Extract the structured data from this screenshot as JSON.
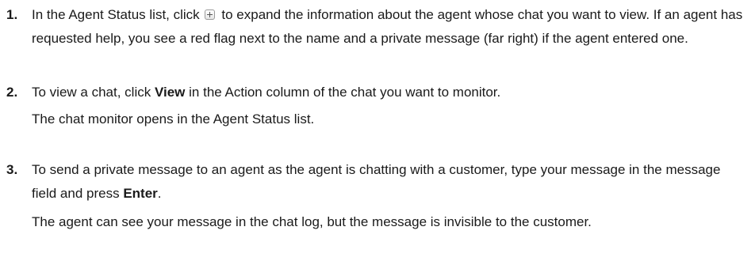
{
  "steps": [
    {
      "number": "1.",
      "text_before_icon": "In the Agent Status list, click",
      "icon": "expand-plus-icon",
      "text_after_icon": "to expand the information about the agent whose chat you want to view. If an agent has requested help, you see a red flag next to the name and a private message (far right) if the agent entered one."
    },
    {
      "number": "2.",
      "text_before_bold": "To view a chat, click",
      "bold": "View",
      "text_after_bold": "in the Action column of the chat you want to monitor.",
      "result": "The chat monitor opens in the Agent Status list."
    },
    {
      "number": "3.",
      "text_before_bold": "To send a private message to an agent as the agent is chatting with a customer, type your message in the message field and press",
      "bold": "Enter",
      "text_after_bold": ".",
      "result": "The agent can see your message in the chat log, but the message is invisible to the customer."
    }
  ]
}
